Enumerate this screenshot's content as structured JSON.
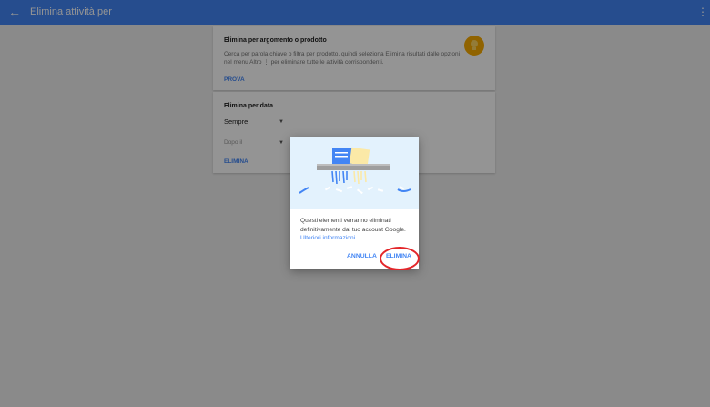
{
  "appbar": {
    "title": "Elimina attività per",
    "back_icon": "arrow-back-icon",
    "menu_icon": "more-vert-icon",
    "color": "#4285f4"
  },
  "by_topic": {
    "title": "Elimina per argomento o prodotto",
    "description": "Cerca per parola chiave o filtra per prodotto, quindi seleziona Elimina risultati dalle opzioni nel menu Altro ⋮ per eliminare tutte le attività corrispondenti.",
    "action": "PROVA",
    "icon": "lightbulb-icon"
  },
  "by_date": {
    "title": "Elimina per data",
    "range_value": "Sempre",
    "after_value": "Dopo il",
    "action": "ELIMINA"
  },
  "dialog": {
    "message": "Questi elementi verranno eliminati definitivamente dal tuo account Google.",
    "learn_more": "Ulteriori informazioni",
    "cancel_label": "ANNULLA",
    "confirm_label": "ELIMINA",
    "illustration": "shredder-illustration",
    "highlight_color": "#e3262a"
  }
}
